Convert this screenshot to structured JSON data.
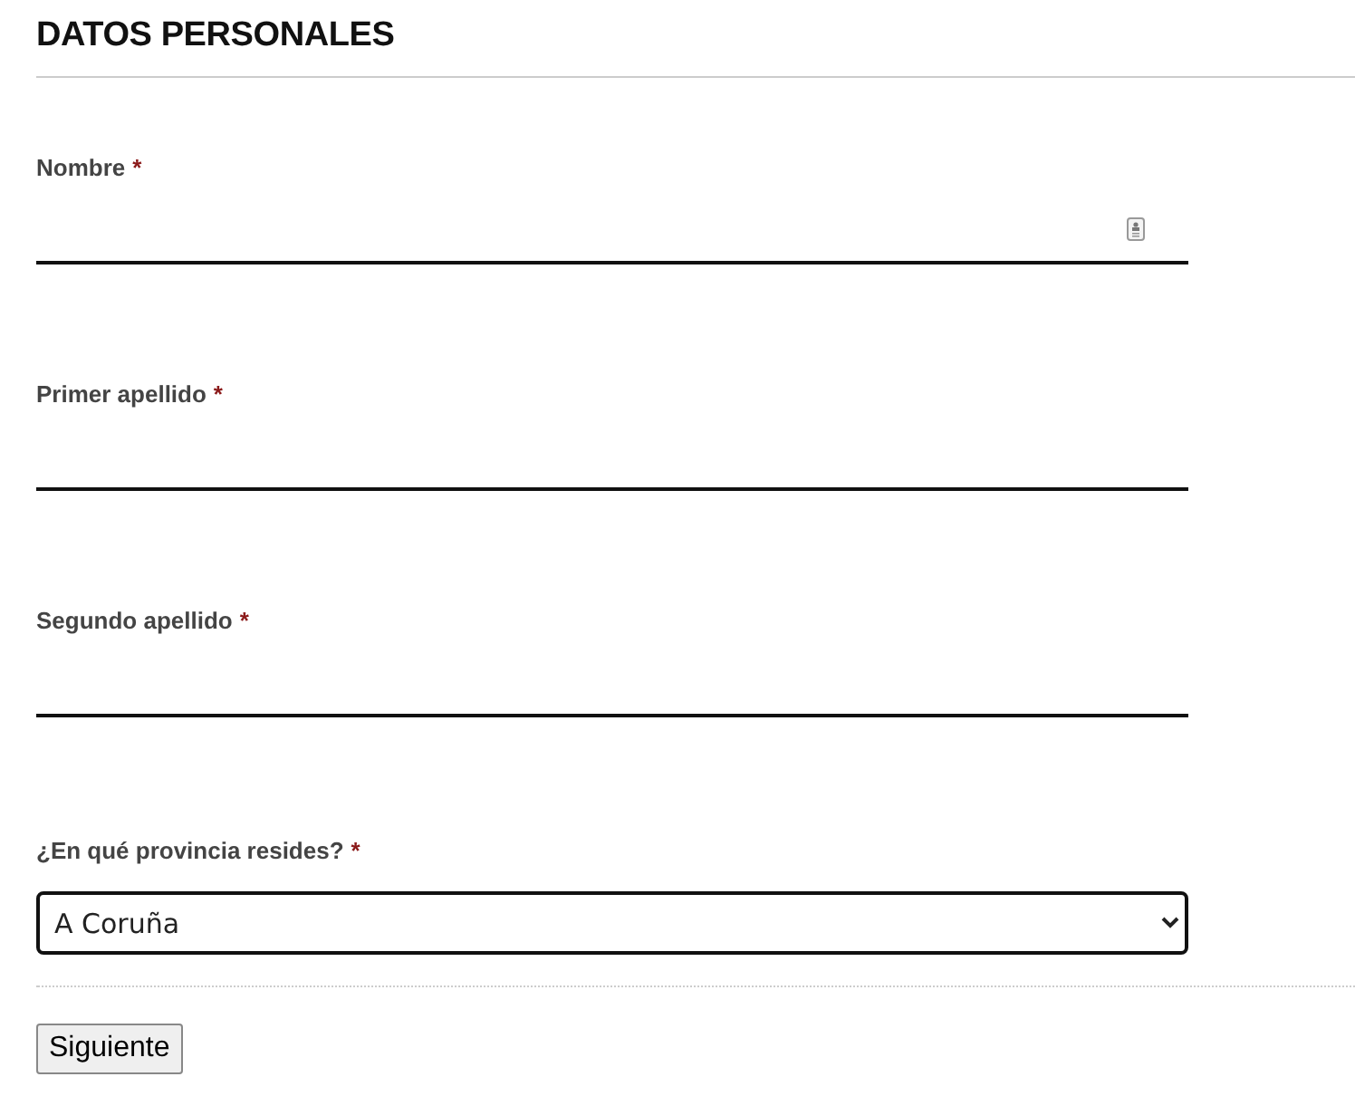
{
  "section_title": "DATOS PERSONALES",
  "fields": [
    {
      "kind": "text",
      "label": "Nombre",
      "required_mark": "*",
      "autofill_icon": true
    },
    {
      "kind": "text",
      "label": "Primer apellido",
      "required_mark": "*",
      "autofill_icon": false
    },
    {
      "kind": "text",
      "label": "Segundo apellido",
      "required_mark": "*",
      "autofill_icon": false
    },
    {
      "kind": "select",
      "label": "¿En qué provincia resides?",
      "required_mark": "*",
      "value": "A Coruña"
    }
  ],
  "buttons": [
    "Siguiente"
  ]
}
